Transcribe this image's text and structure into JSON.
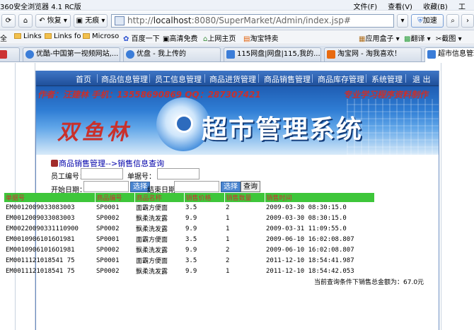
{
  "browser": {
    "title": "360安全浏览器 4.1 RC版",
    "menus": [
      "文件(F)",
      "查看(V)",
      "收藏(B)",
      "工"
    ],
    "back_label": "恢复",
    "trace_label": "无痕",
    "url_prefix": "http://",
    "url_host": "localhost",
    "url_rest": ":8080/SuperMarket/Admin/index.jsp#",
    "accelerate_label": "加速",
    "bookmarks": [
      "全",
      "Links",
      "Links fo",
      "Microso",
      "百度一下",
      "高清免费",
      "上网主页",
      "淘宝特卖",
      "应用盒子",
      "翻译",
      "截图"
    ],
    "tabs": [
      "优酷-中国第一视频网站,...",
      "优盘 - 我上传的",
      "115网盘|网盘|115,我的...",
      "淘宝网 - 淘我喜欢！",
      "超市信息管理"
    ]
  },
  "site": {
    "nav": [
      "首页",
      "商品信息管理",
      "员工信息管理",
      "商品进货管理",
      "商品销售管理",
      "商品库存管理",
      "系统管理",
      "退 出"
    ],
    "banner": {
      "author": "作者：汪建林      手机：13558690869      QQ：287307421",
      "slogan": "专业学习程序资料制作",
      "brand": "双鱼林",
      "title": "超市管理系统"
    },
    "breadcrumb": "商品销售管理-->销售信息查询",
    "form": {
      "employee_label": "员工编号：",
      "bill_label": "单据号：",
      "start_label": "开始日期：",
      "end_label": "结束日期",
      "select_label": "选择",
      "query_label": "查询"
    },
    "table": {
      "headers": [
        "单据号",
        "商品编号",
        "商品名称",
        "销售价格",
        "销售数量",
        "销售时间"
      ],
      "rows": [
        [
          "EM0012009033083003",
          "SP0001",
          "面霸方便面",
          "3.5",
          "2",
          "2009-03-30 08:30:15.0"
        ],
        [
          "EM0012009033083003",
          "SP0002",
          "飘柔洗发露",
          "9.9",
          "1",
          "2009-03-30 08:30:15.0"
        ],
        [
          "EM00220090331110900",
          "SP0002",
          "飘柔洗发露",
          "9.9",
          "1",
          "2009-03-31 11:09:55.0"
        ],
        [
          "EM00109061016O1981",
          "SP0001",
          "面霸方便面",
          "3.5",
          "1",
          "2009-06-10 16:02:08.807"
        ],
        [
          "EM00109061016O1981",
          "SP0002",
          "飘柔洗发露",
          "9.9",
          "2",
          "2009-06-10 16:02:08.807"
        ],
        [
          "EM0011121018541 75",
          "SP0001",
          "面霸方便面",
          "3.5",
          "2",
          "2011-12-10 18:54:41.987"
        ],
        [
          "EM0011121018541 75",
          "SP0002",
          "飘柔洗发露",
          "9.9",
          "1",
          "2011-12-10 18:54:42.053"
        ]
      ]
    },
    "total": "当前查询条件下销售总金额为：67.0元"
  }
}
